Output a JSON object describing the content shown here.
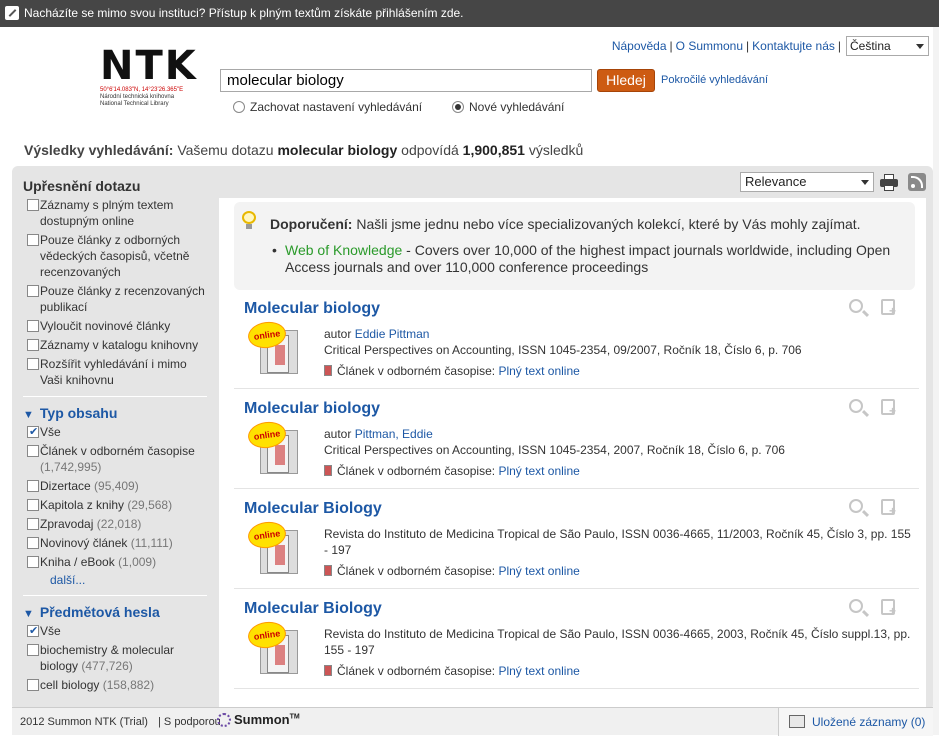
{
  "notice": {
    "text": "Nacházíte se mimo svou instituci? Přístup k plným textům získáte přihlášením zde."
  },
  "top_links": {
    "help": "Nápověda",
    "about": "O Summonu",
    "contact": "Kontaktujte nás",
    "language": "Čeština"
  },
  "logo": {
    "name": "NTK",
    "coordinates": "50°6'14.083\"N, 14°23'26.365\"E",
    "line1": "Národní technická knihovna",
    "line2": "National Technical Library"
  },
  "search": {
    "query": "molecular biology",
    "button": "Hledej",
    "advanced": "Pokročilé vyhledávání",
    "option_keep": "Zachovat nastavení vyhledávání",
    "option_new": "Nové vyhledávání",
    "selected_option": "new"
  },
  "summary": {
    "label": "Výsledky vyhledávání:",
    "before": "Vašemu dotazu",
    "query": "molecular biology",
    "middle": "odpovídá",
    "count": "1,900,851",
    "after": "výsledků"
  },
  "sort": {
    "selected": "Relevance"
  },
  "sidebar": {
    "title": "Upřesnění dotazu",
    "refine_options": [
      "Záznamy s plným textem dostupným online",
      "Pouze články z odborných vědeckých časopisů, včetně recenzovaných",
      "Pouze články z recenzovaných publikací",
      "Vyloučit novinové články",
      "Záznamy v katalogu knihovny",
      "Rozšířit vyhledávání i mimo Vaši knihovnu"
    ],
    "content_type": {
      "title": "Typ obsahu",
      "items": [
        {
          "label": "Vše",
          "count": "",
          "checked": true
        },
        {
          "label": "Článek v odborném časopise",
          "count": "(1,742,995)",
          "checked": false
        },
        {
          "label": "Dizertace",
          "count": "(95,409)",
          "checked": false
        },
        {
          "label": "Kapitola z knihy",
          "count": "(29,568)",
          "checked": false
        },
        {
          "label": "Zpravodaj",
          "count": "(22,018)",
          "checked": false
        },
        {
          "label": "Novinový článek",
          "count": "(11,111)",
          "checked": false
        },
        {
          "label": "Kniha / eBook",
          "count": "(1,009)",
          "checked": false
        }
      ],
      "more": "další..."
    },
    "subjects": {
      "title": "Předmětová hesla",
      "items": [
        {
          "label": "Vše",
          "count": "",
          "checked": true
        },
        {
          "label": "biochemistry & molecular biology",
          "count": "(477,726)",
          "checked": false
        },
        {
          "label": "cell biology",
          "count": "(158,882)",
          "checked": false
        }
      ]
    }
  },
  "recommendation": {
    "label": "Doporučení:",
    "text": "Našli jsme jednu nebo více specializovaných kolekcí, které by Vás mohly zajímat.",
    "link": "Web of Knowledge",
    "desc": " - Covers over 10,000 of the highest impact journals worldwide, including Open Access journals and over 110,000 conference proceedings"
  },
  "results": [
    {
      "title": "Molecular biology",
      "author_label": "autor",
      "author": "Eddie Pittman",
      "source": "Critical Perspectives on Accounting, ISSN 1045-2354, 09/2007, Ročník 18, Číslo 6, p. 706",
      "type": "Článek v odborném časopise:",
      "fulltext": "Plný text online",
      "badge": "online"
    },
    {
      "title": "Molecular biology",
      "author_label": "autor",
      "author": "Pittman, Eddie",
      "source": "Critical Perspectives on Accounting, ISSN 1045-2354, 2007, Ročník 18, Číslo 6, p. 706",
      "type": "Článek v odborném časopise:",
      "fulltext": "Plný text online",
      "badge": "online"
    },
    {
      "title": "Molecular Biology",
      "source": "Revista do Instituto de Medicina Tropical de São Paulo, ISSN 0036-4665, 11/2003, Ročník 45, Číslo 3, pp. 155 - 197",
      "type": "Článek v odborném časopise:",
      "fulltext": "Plný text online",
      "badge": "online"
    },
    {
      "title": "Molecular Biology",
      "source": "Revista do Instituto de Medicina Tropical de São Paulo, ISSN 0036-4665, 2003, Ročník 45, Číslo suppl.13, pp. 155 - 197",
      "type": "Článek v odborném časopise:",
      "fulltext": "Plný text online",
      "badge": "online"
    }
  ],
  "footer": {
    "copyright": "2012 Summon NTK (Trial)",
    "powered": "S podporou",
    "brand": "Summon",
    "tm": "TM",
    "saved": "Uložené záznamy (0)"
  },
  "icons": [
    "pen-icon",
    "bulb-icon",
    "print-icon",
    "rss-icon",
    "magnifier-icon",
    "add-record-icon",
    "folder-icon"
  ],
  "colors": {
    "accent": "#1d58a5",
    "search_button": "#cd5b12",
    "notice_bar": "#464646",
    "link_green": "#2a9a2a"
  }
}
